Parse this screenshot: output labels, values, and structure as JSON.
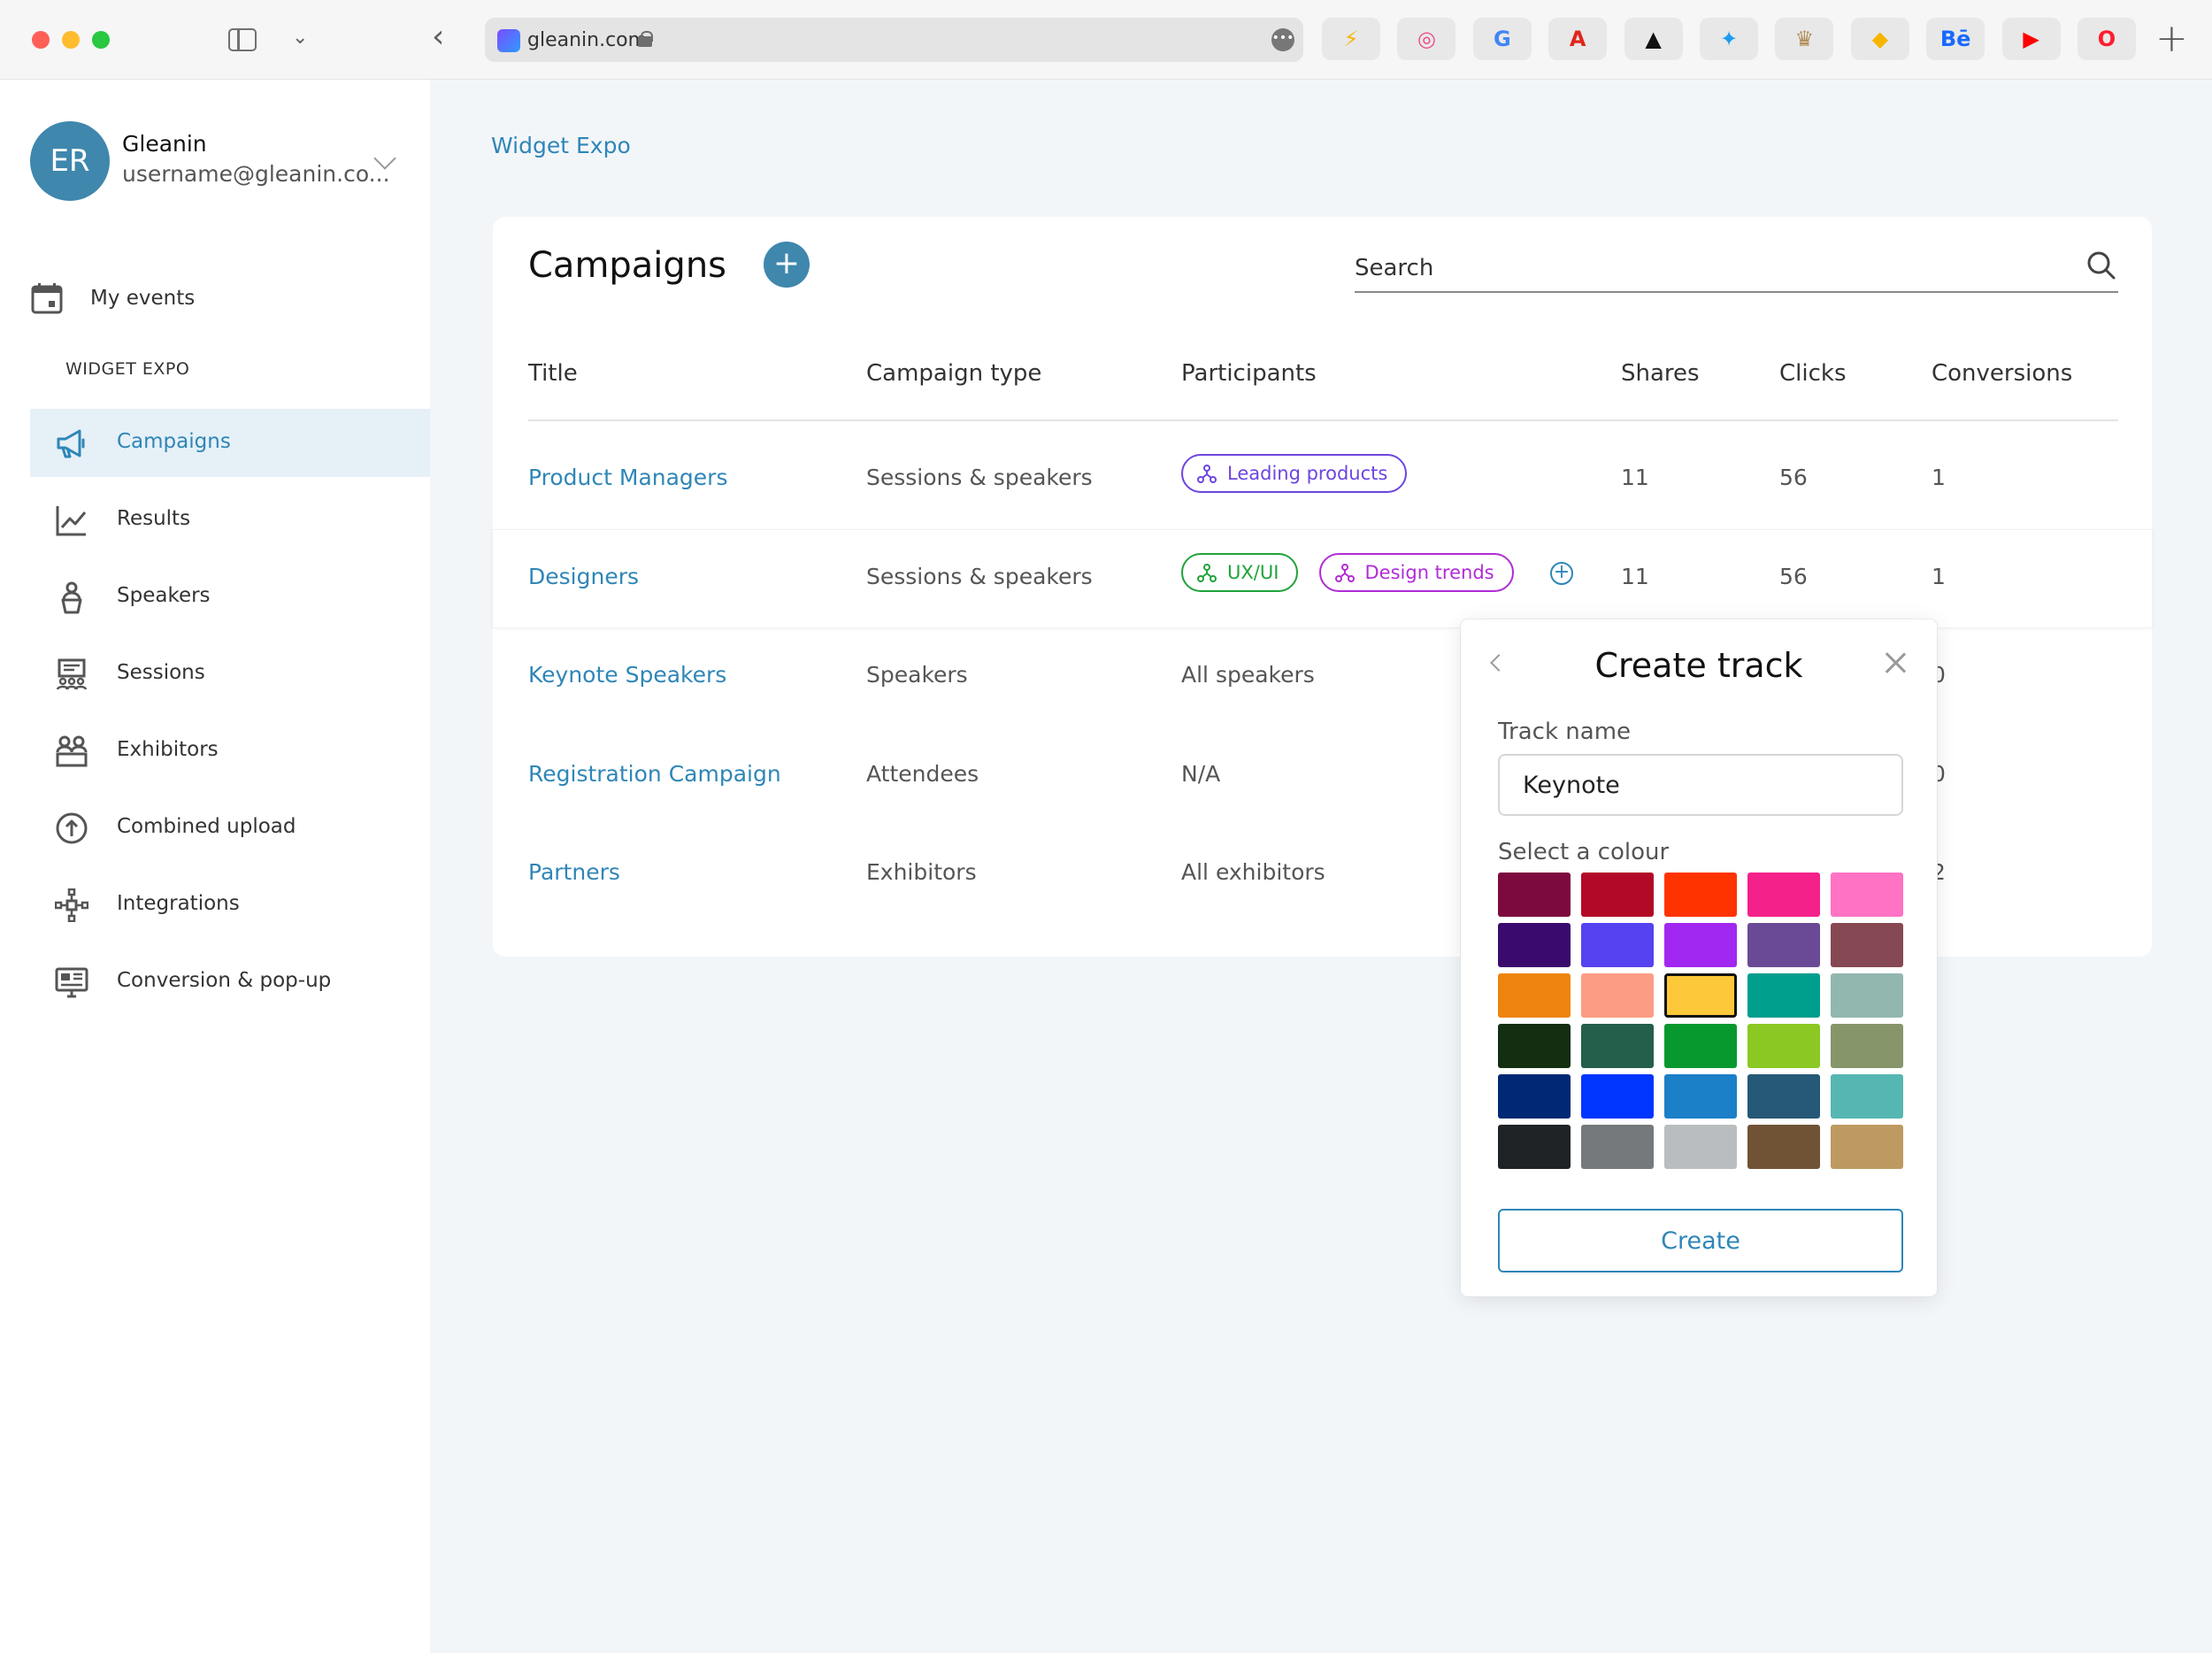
{
  "browser": {
    "url": "gleanin.com",
    "bookmarks": [
      {
        "icon": "bookmark-spark-icon",
        "glyph": "⚡",
        "color": "#f5b400"
      },
      {
        "icon": "bookmark-dribbble-icon",
        "glyph": "◎",
        "color": "#ea4c89"
      },
      {
        "icon": "bookmark-google-icon",
        "glyph": "G",
        "color": "#4285f4"
      },
      {
        "icon": "bookmark-adobe-icon",
        "glyph": "A",
        "color": "#e1251b"
      },
      {
        "icon": "bookmark-adidas-icon",
        "glyph": "▲",
        "color": "#111111"
      },
      {
        "icon": "bookmark-twitter-icon",
        "glyph": "✦",
        "color": "#1d9bf0"
      },
      {
        "icon": "bookmark-crown-icon",
        "glyph": "♛",
        "color": "#b08d57"
      },
      {
        "icon": "bookmark-sketch-icon",
        "glyph": "◆",
        "color": "#f7b500"
      },
      {
        "icon": "bookmark-behance-icon",
        "glyph": "Bē",
        "color": "#1769ff"
      },
      {
        "icon": "bookmark-youtube-icon",
        "glyph": "▶",
        "color": "#ff0000"
      },
      {
        "icon": "bookmark-opera-icon",
        "glyph": "O",
        "color": "#ff1b2d"
      }
    ]
  },
  "account": {
    "initials": "ER",
    "name": "Gleanin",
    "email": "username@gleanin.co..."
  },
  "sidebar": {
    "my_events": "My events",
    "section_label": "WIDGET EXPO",
    "items": [
      {
        "label": "Campaigns",
        "icon": "megaphone-icon",
        "active": true
      },
      {
        "label": "Results",
        "icon": "line-chart-icon",
        "active": false
      },
      {
        "label": "Speakers",
        "icon": "speaker-podium-icon",
        "active": false
      },
      {
        "label": "Sessions",
        "icon": "sessions-board-icon",
        "active": false
      },
      {
        "label": "Exhibitors",
        "icon": "exhibitors-icon",
        "active": false
      },
      {
        "label": "Combined upload",
        "icon": "upload-circle-icon",
        "active": false
      },
      {
        "label": "Integrations",
        "icon": "integrations-icon",
        "active": false
      },
      {
        "label": "Conversion & pop-up",
        "icon": "popup-monitor-icon",
        "active": false
      }
    ]
  },
  "main": {
    "breadcrumb": "Widget Expo",
    "title": "Campaigns",
    "search_placeholder": "Search",
    "columns": [
      "Title",
      "Campaign type",
      "Participants",
      "Shares",
      "Clicks",
      "Conversions"
    ],
    "rows": [
      {
        "title": "Product Managers",
        "type": "Sessions & speakers",
        "participants_text": "",
        "chips": [
          {
            "label": "Leading products",
            "style": "purple"
          }
        ],
        "add_chip": false,
        "shares": "11",
        "clicks": "56",
        "conversions": "1",
        "highlight": false
      },
      {
        "title": "Designers",
        "type": "Sessions & speakers",
        "participants_text": "",
        "chips": [
          {
            "label": "UX/UI",
            "style": "green"
          },
          {
            "label": "Design trends",
            "style": "magenta"
          }
        ],
        "add_chip": true,
        "shares": "11",
        "clicks": "56",
        "conversions": "1",
        "highlight": true
      },
      {
        "title": "Keynote Speakers",
        "type": "Speakers",
        "participants_text": "All speakers",
        "chips": [],
        "add_chip": false,
        "shares": "",
        "clicks": "",
        "conversions": "0",
        "highlight": false
      },
      {
        "title": "Registration Campaign",
        "type": "Attendees",
        "participants_text": "N/A",
        "chips": [],
        "add_chip": false,
        "shares": "",
        "clicks": "",
        "conversions": "0",
        "highlight": false
      },
      {
        "title": "Partners",
        "type": "Exhibitors",
        "participants_text": "All exhibitors",
        "chips": [],
        "add_chip": false,
        "shares": "",
        "clicks": "",
        "conversions": "2",
        "highlight": false
      }
    ]
  },
  "popover": {
    "title": "Create track",
    "track_name_label": "Track name",
    "track_name_value": "Keynote",
    "colour_label": "Select a colour",
    "selected_colour": "#fdc93a",
    "colours": [
      "#7d0a3f",
      "#b20a26",
      "#ff3300",
      "#f5218a",
      "#ff72c4",
      "#3a0a6e",
      "#5542f0",
      "#a128f0",
      "#6a4a96",
      "#864852",
      "#ee840d",
      "#fd9c84",
      "#fdc93a",
      "#009e8d",
      "#92b7af",
      "#142e12",
      "#235f4b",
      "#07992e",
      "#8cc823",
      "#87956a",
      "#012874",
      "#0035ff",
      "#1b80c8",
      "#265877",
      "#56b6b1",
      "#202326",
      "#75797c",
      "#b9bdc0",
      "#705335",
      "#bd9a61"
    ],
    "create_label": "Create"
  }
}
